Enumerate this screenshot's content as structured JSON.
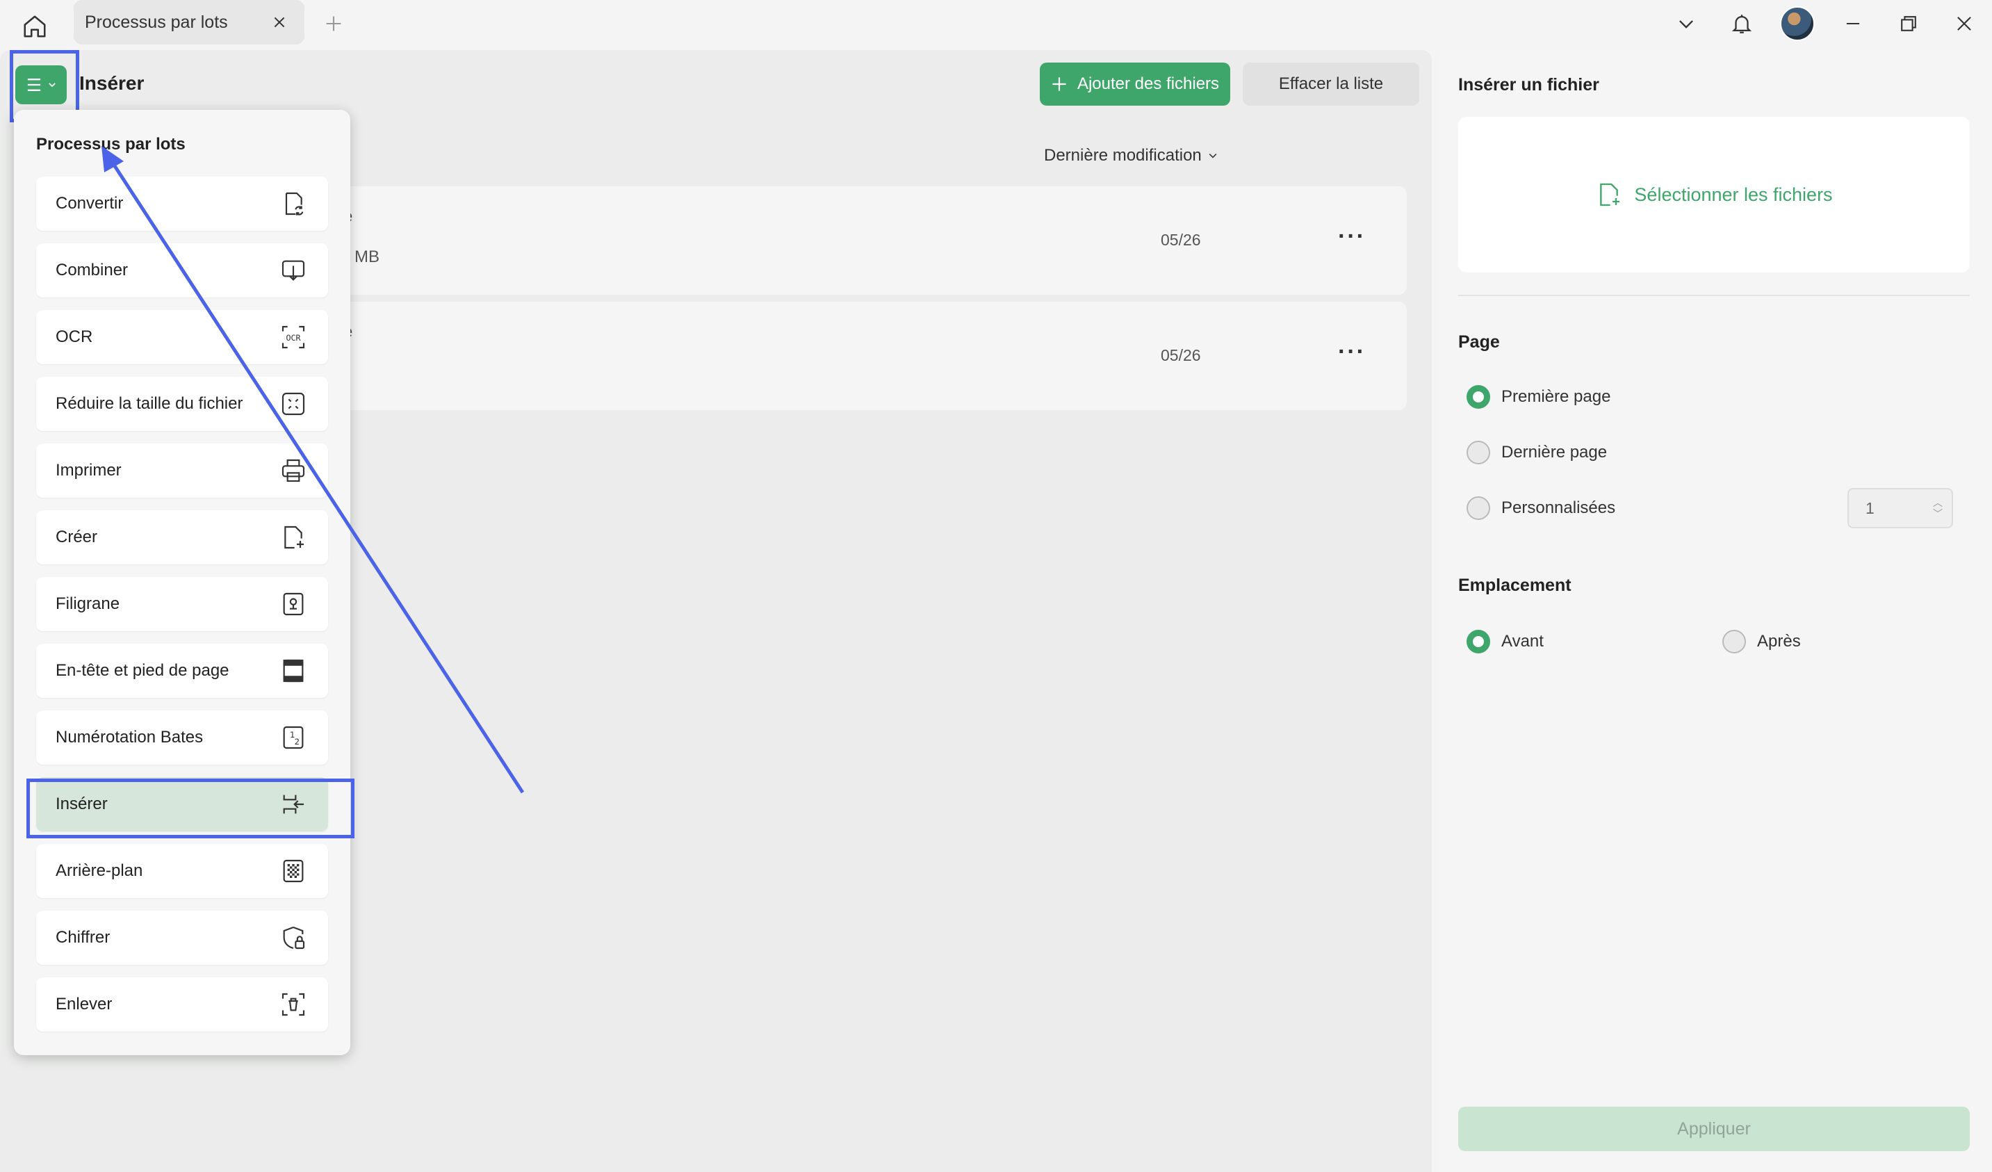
{
  "tab": {
    "title": "Processus par lots"
  },
  "header": {
    "title": "Insérer",
    "add_files": "Ajouter des fichiers",
    "clear_list": "Effacer la liste"
  },
  "list": {
    "sort_label": "Dernière modification",
    "rows": [
      {
        "frag1": "e",
        "frag2": "MB",
        "date": "05/26"
      },
      {
        "frag1": "e",
        "frag2": "",
        "date": "05/26"
      }
    ]
  },
  "dropdown": {
    "title": "Processus par lots",
    "items": [
      {
        "label": "Convertir",
        "icon": "convert-icon"
      },
      {
        "label": "Combiner",
        "icon": "combine-icon"
      },
      {
        "label": "OCR",
        "icon": "ocr-icon"
      },
      {
        "label": "Réduire la taille du fichier",
        "icon": "compress-icon"
      },
      {
        "label": "Imprimer",
        "icon": "print-icon"
      },
      {
        "label": "Créer",
        "icon": "create-icon"
      },
      {
        "label": "Filigrane",
        "icon": "watermark-icon"
      },
      {
        "label": "En-tête et pied de page",
        "icon": "header-footer-icon"
      },
      {
        "label": "Numérotation Bates",
        "icon": "bates-icon"
      },
      {
        "label": "Insérer",
        "icon": "insert-icon"
      },
      {
        "label": "Arrière-plan",
        "icon": "background-icon"
      },
      {
        "label": "Chiffrer",
        "icon": "encrypt-icon"
      },
      {
        "label": "Enlever",
        "icon": "remove-icon"
      }
    ]
  },
  "side": {
    "title": "Insérer un fichier",
    "select_files": "Sélectionner les fichiers",
    "page_section": "Page",
    "page_options": [
      "Première page",
      "Dernière page",
      "Personnalisées"
    ],
    "page_selected": "Première page",
    "custom_value": "1",
    "location_section": "Emplacement",
    "location_options": [
      "Avant",
      "Après"
    ],
    "location_selected": "Avant",
    "apply": "Appliquer"
  },
  "colors": {
    "accent": "#3fa66b",
    "highlight": "#4a63e8"
  }
}
